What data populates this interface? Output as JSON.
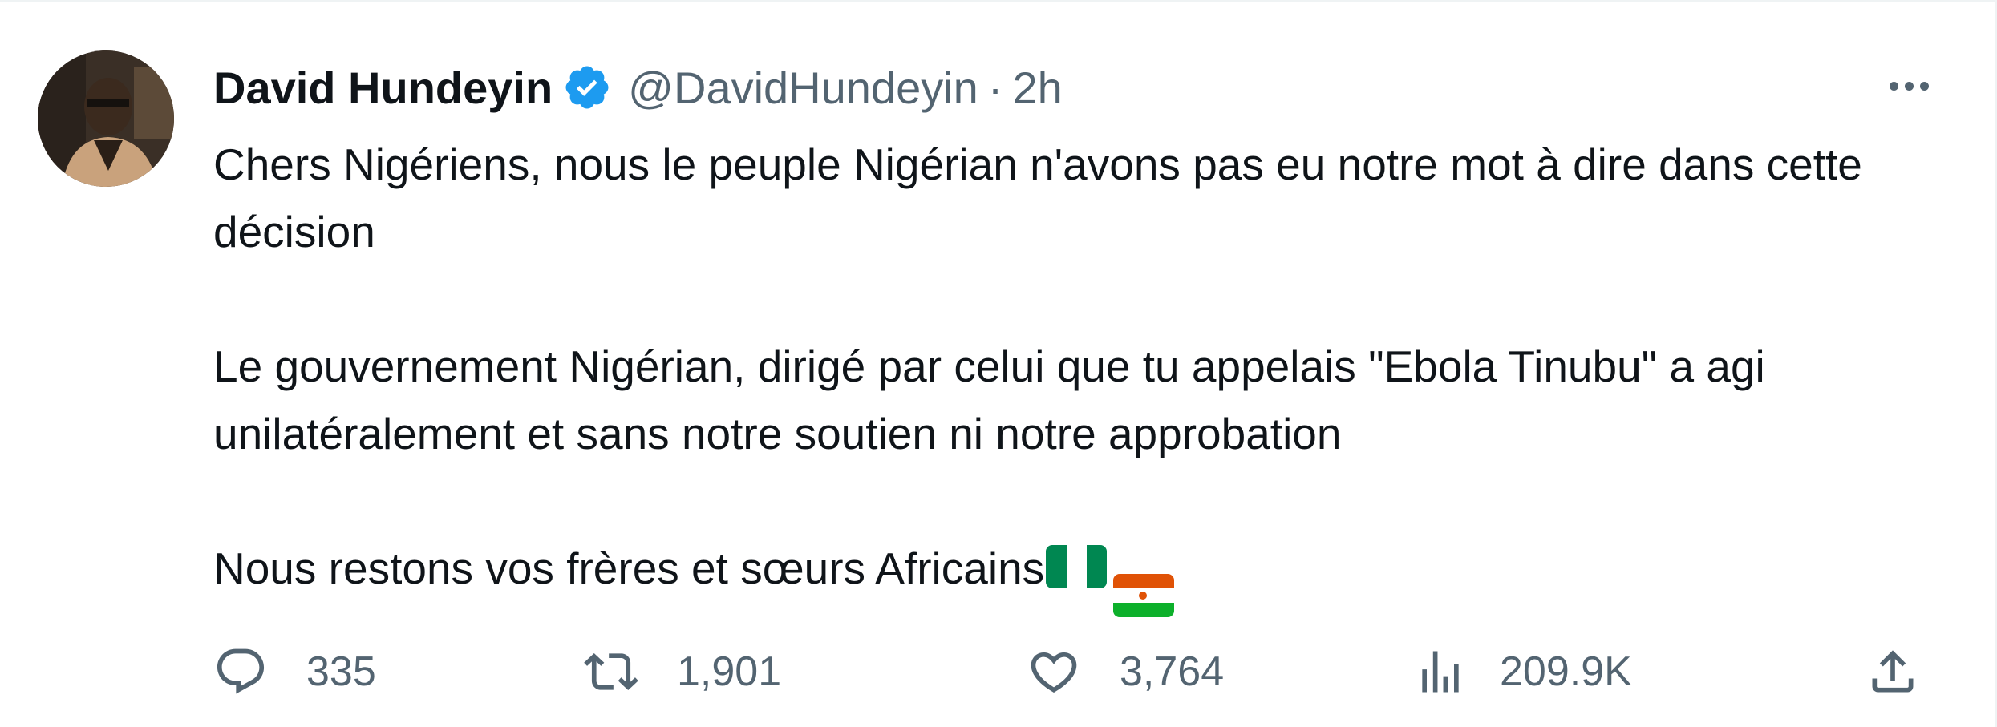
{
  "author": {
    "name": "David Hundeyin",
    "handle": "@DavidHundeyin",
    "separator": "·",
    "time": "2h",
    "verified": true,
    "verified_color": "#1d9bf0"
  },
  "tweet": {
    "paragraphs": [
      "Chers Nigériens, nous le peuple Nigérian n'avons pas eu notre mot à dire dans cette décision",
      "Le gouvernement Nigérian, dirigé par celui que tu appelais \"Ebola Tinubu\" a agi unilatéralement et sans notre soutien ni notre approbation",
      "Nous restons vos frères et sœurs Africains"
    ],
    "emoji": [
      "nigeria-flag",
      "niger-flag"
    ]
  },
  "actions": {
    "reply": {
      "icon": "reply-icon",
      "count": "335"
    },
    "retweet": {
      "icon": "retweet-icon",
      "count": "1,901"
    },
    "like": {
      "icon": "heart-icon",
      "count": "3,764"
    },
    "views": {
      "icon": "views-icon",
      "count": "209.9K"
    },
    "share": {
      "icon": "share-icon"
    }
  },
  "colors": {
    "text": "#0f1419",
    "secondary": "#536471",
    "nigeria_green": "#008751",
    "niger_orange": "#e05206",
    "niger_green": "#0db02b"
  }
}
